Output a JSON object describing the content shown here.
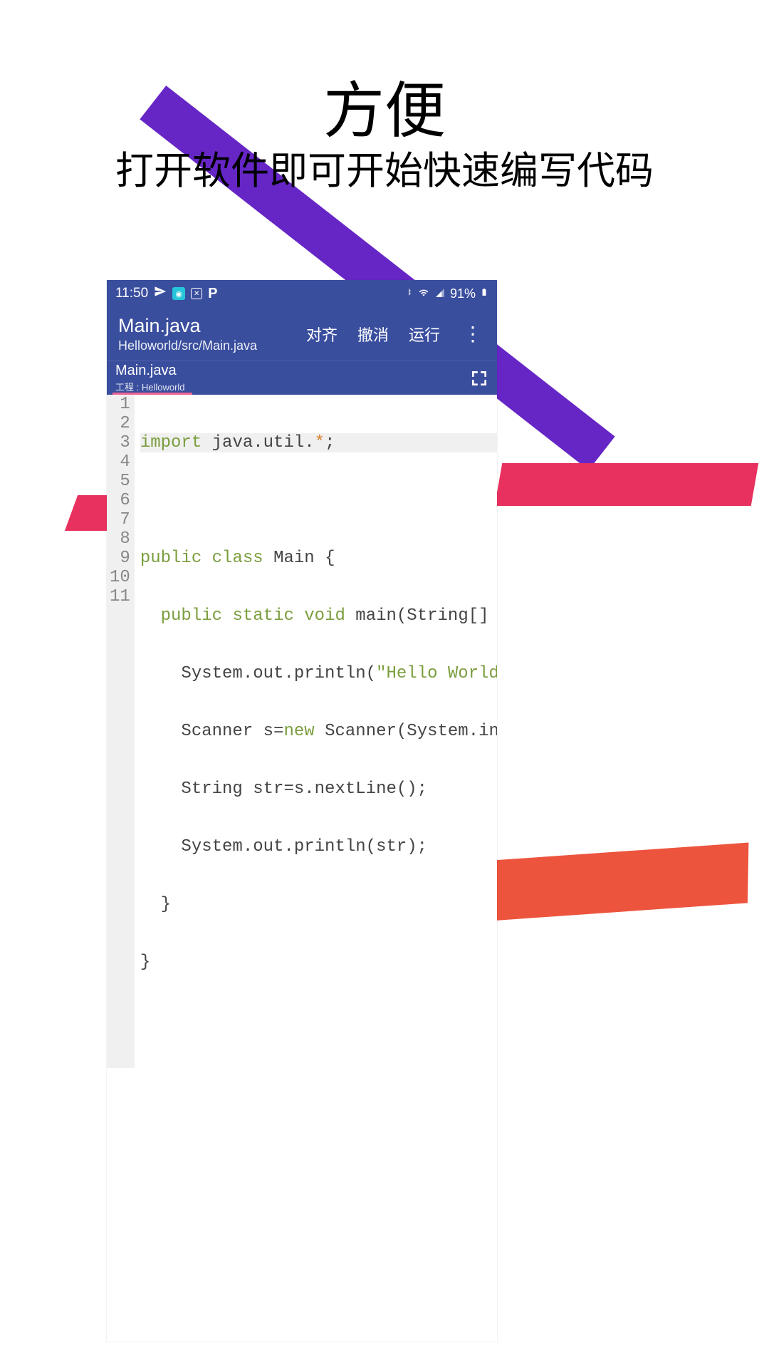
{
  "promo": {
    "title": "方便",
    "subtitle": "打开软件即可开始快速编写代码"
  },
  "status": {
    "time": "11:50",
    "battery": "91%"
  },
  "appbar": {
    "title": "Main.java",
    "subtitle": "Helloworld/src/Main.java",
    "actions": {
      "align": "对齐",
      "undo": "撤消",
      "run": "运行"
    }
  },
  "tab": {
    "filename": "Main.java",
    "project": "工程 : Helloworld"
  },
  "code": {
    "lines": [
      {
        "n": "1",
        "raw": "import java.util.*;"
      },
      {
        "n": "2",
        "raw": ""
      },
      {
        "n": "3",
        "raw": "public class Main {"
      },
      {
        "n": "4",
        "raw": "  public static void main(String[]"
      },
      {
        "n": "5",
        "raw": "    System.out.println(\"Hello World"
      },
      {
        "n": "6",
        "raw": "    Scanner s=new Scanner(System.in"
      },
      {
        "n": "7",
        "raw": "    String str=s.nextLine();"
      },
      {
        "n": "8",
        "raw": "    System.out.println(str);"
      },
      {
        "n": "9",
        "raw": "  }"
      },
      {
        "n": "10",
        "raw": "}"
      },
      {
        "n": "11",
        "raw": ""
      }
    ]
  }
}
